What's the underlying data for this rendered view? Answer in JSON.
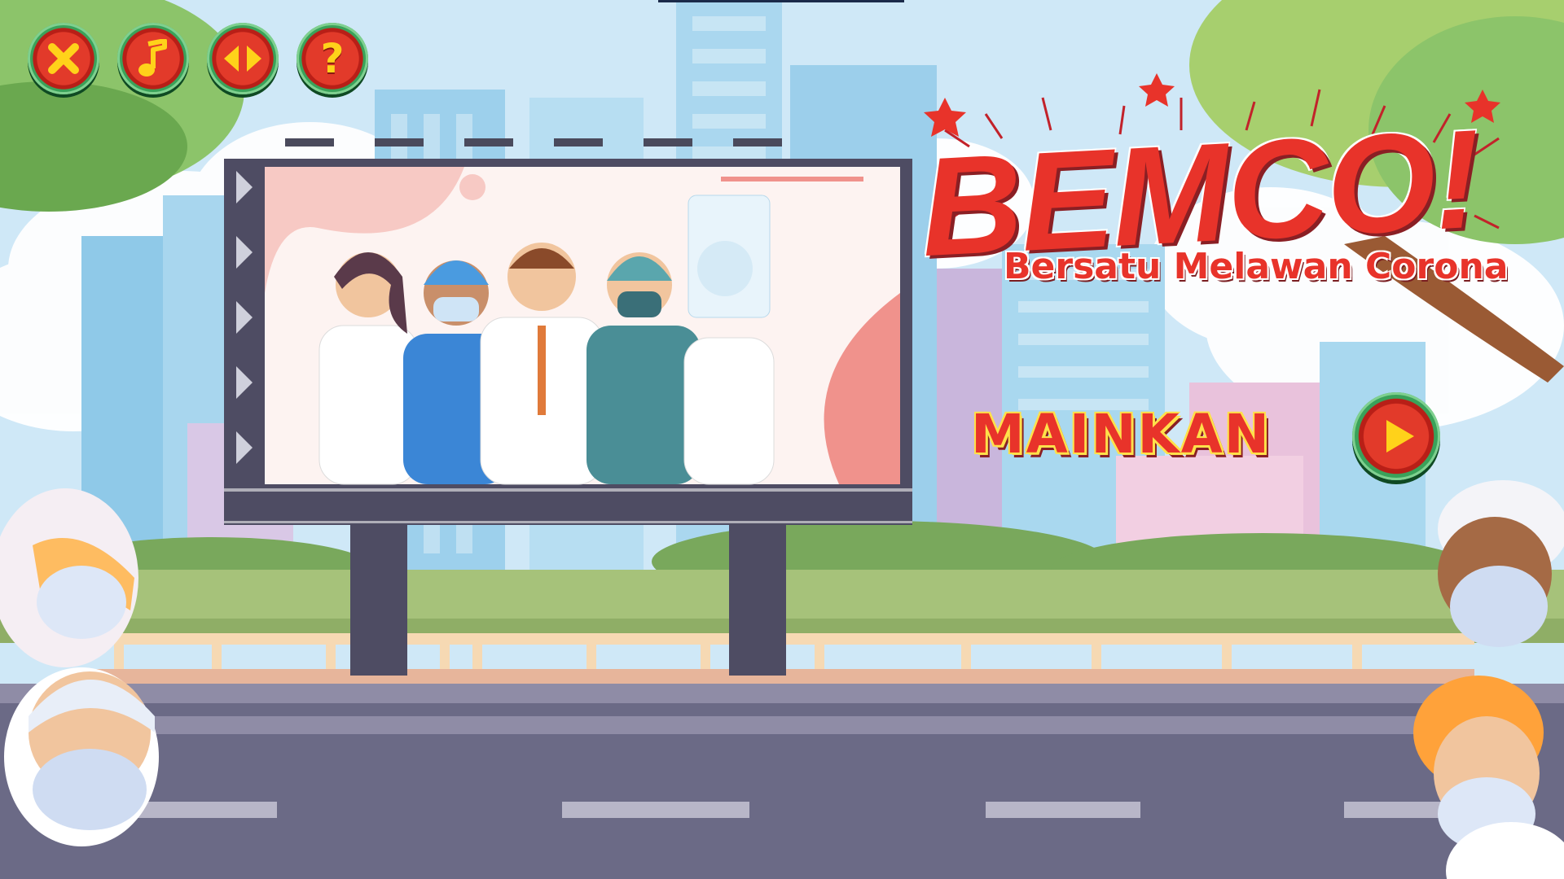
{
  "toolbar": {
    "exit_icon": "close-icon",
    "music_icon": "music-note-icon",
    "fullscreen_icon": "arrows-left-right-icon",
    "help_icon": "question-icon",
    "help_glyph": "?"
  },
  "title": {
    "main": "BEMCO!",
    "subtitle": "Bersatu Melawan Corona"
  },
  "play": {
    "label": "MAINKAN",
    "icon": "play-icon"
  },
  "colors": {
    "accent_red": "#e8332a",
    "button_green": "#3aa25a",
    "glyph_yellow": "#ffd21a",
    "sky": "#cfe8f7",
    "road": "#6b6a86"
  }
}
